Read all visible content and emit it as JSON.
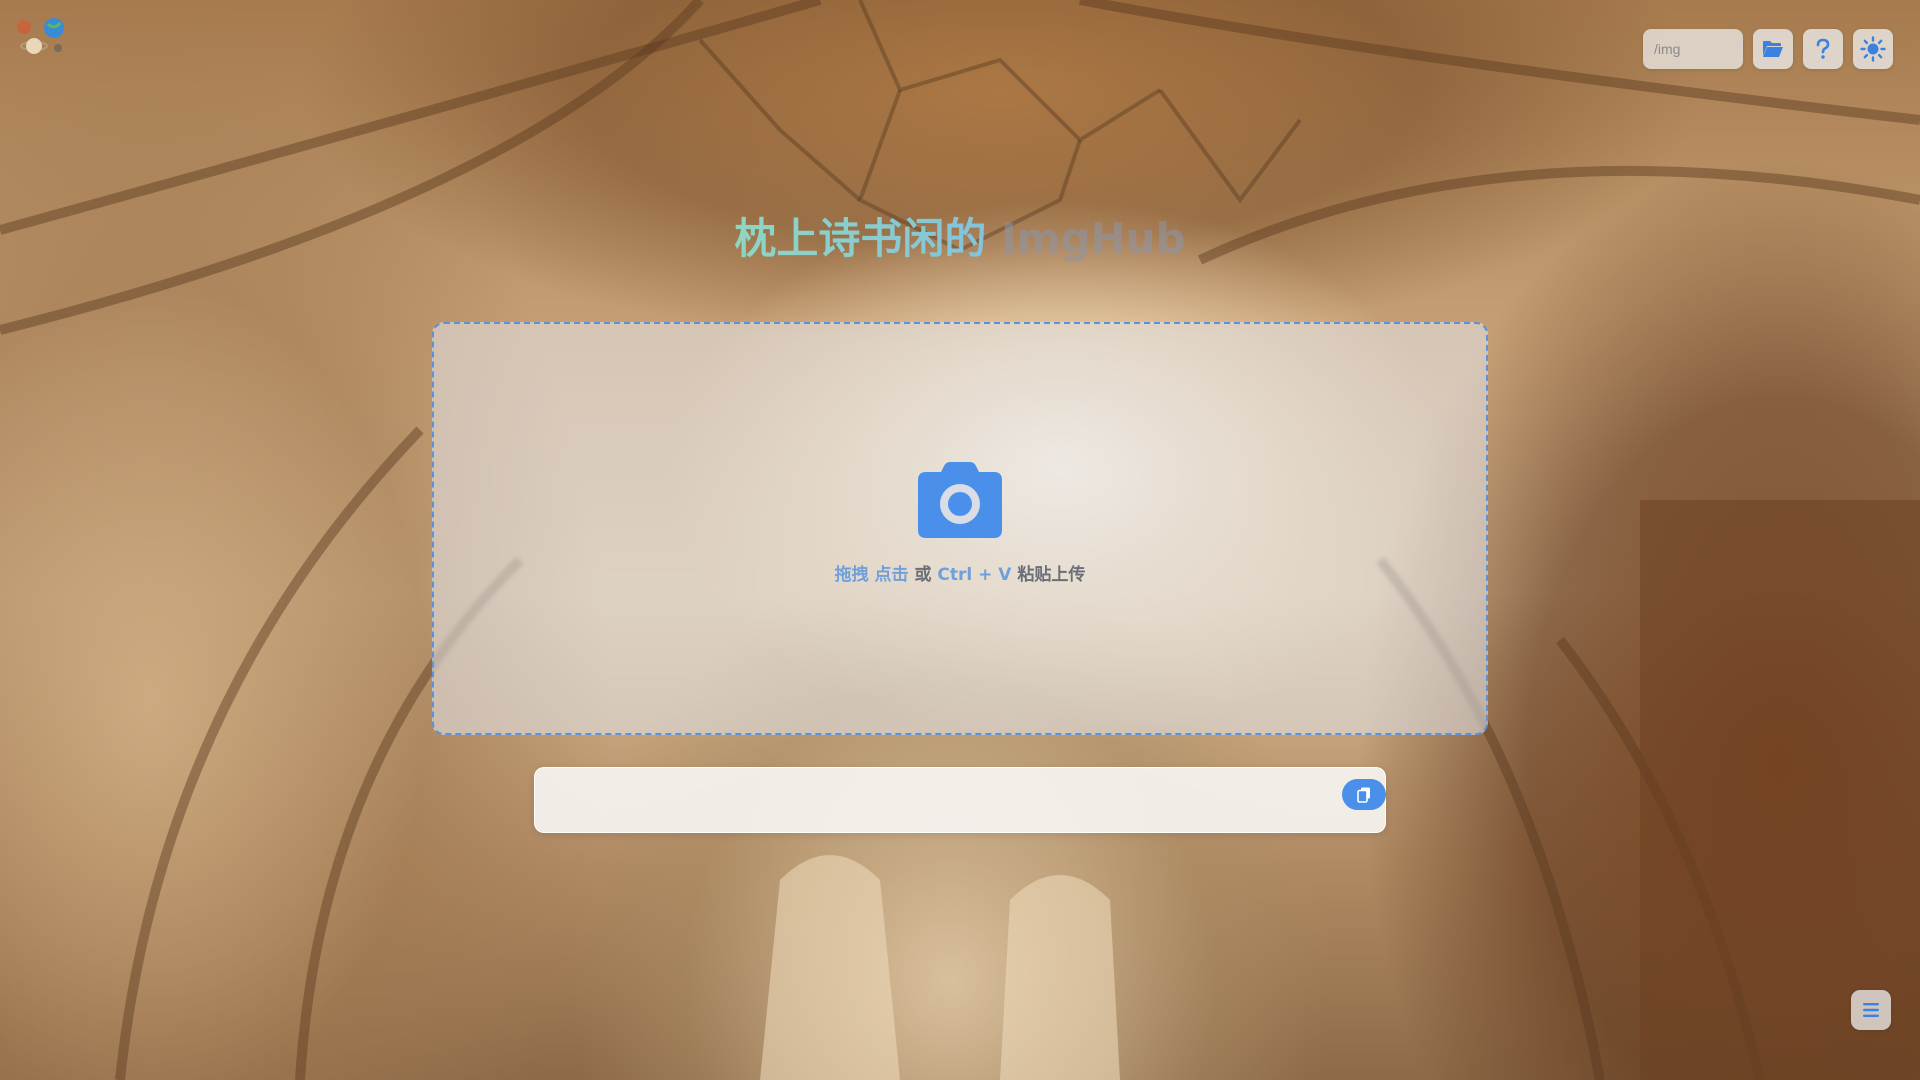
{
  "header": {
    "path_placeholder": "/img",
    "buttons": [
      {
        "name": "folder",
        "icon": "folder-open-icon"
      },
      {
        "name": "help",
        "icon": "question-icon"
      },
      {
        "name": "theme",
        "icon": "sun-icon"
      }
    ]
  },
  "logo": {
    "icon": "planets-logo-icon"
  },
  "title": {
    "primary": "枕上诗书闲的",
    "secondary": " ImgHub"
  },
  "upload": {
    "icon": "camera-icon",
    "drag_label": "拖拽",
    "click_label": "点击",
    "or_label": " 或 ",
    "shortcut_label": "Ctrl + V",
    "paste_label": " 粘贴上传"
  },
  "result": {
    "value": "",
    "copy_icon": "copy-icon"
  },
  "menu": {
    "icon": "menu-icon"
  },
  "colors": {
    "accent": "#4a8fea",
    "dashed_border": "#5a93dc",
    "title_gradient_start": "#8fd6c2",
    "title_gradient_end": "#84c3dc"
  }
}
